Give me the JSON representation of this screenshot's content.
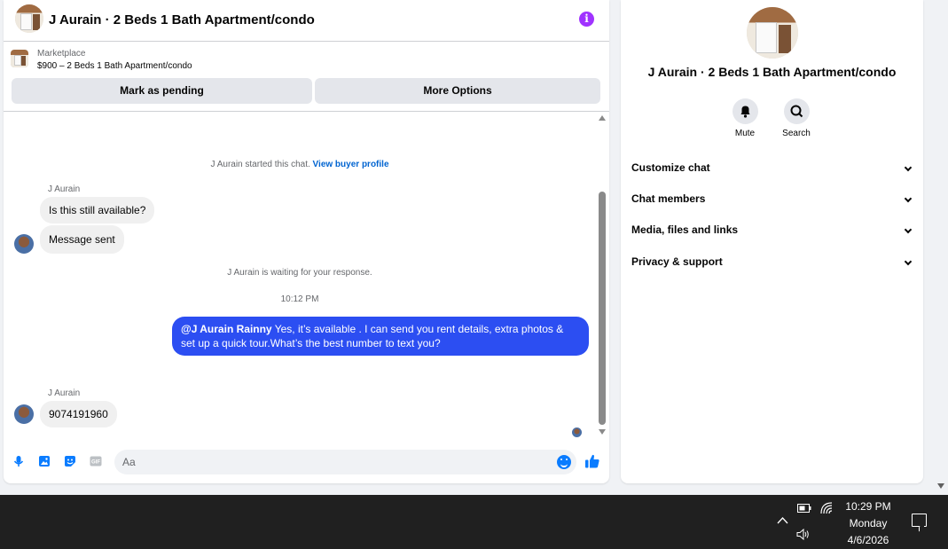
{
  "chat": {
    "header_title": "J Aurain · 2 Beds 1 Bath Apartment/condo",
    "marketplace_label": "Marketplace",
    "listing_text": "$900 – 2 Beds 1 Bath Apartment/condo",
    "mark_pending_label": "Mark as pending",
    "more_options_label": "More Options",
    "started_text": "J Aurain started this chat.",
    "view_profile_link": "View buyer profile",
    "sender_name_1": "J Aurain",
    "message_1": "Is this still available?",
    "message_2": "Message sent",
    "waiting_text": "J Aurain is waiting for your response.",
    "timestamp": "10:12 PM",
    "outgoing_mention": "@J Aurain Rainny",
    "outgoing_text": " Yes, it’s available .  I can send you rent details, extra photos & set up a quick tour.What’s the best number to text you?",
    "sender_name_2": "J Aurain",
    "message_3": "9074191960",
    "composer_placeholder": "Aa",
    "accent_color": "#2c4ef2"
  },
  "info": {
    "title": "J Aurain · 2 Beds 1 Bath Apartment/condo",
    "mute_label": "Mute",
    "search_label": "Search",
    "sections": [
      "Customize chat",
      "Chat members",
      "Media, files and links",
      "Privacy & support"
    ]
  },
  "taskbar": {
    "time": "10:29 PM",
    "day": "Monday",
    "date": "4/6/2026"
  }
}
